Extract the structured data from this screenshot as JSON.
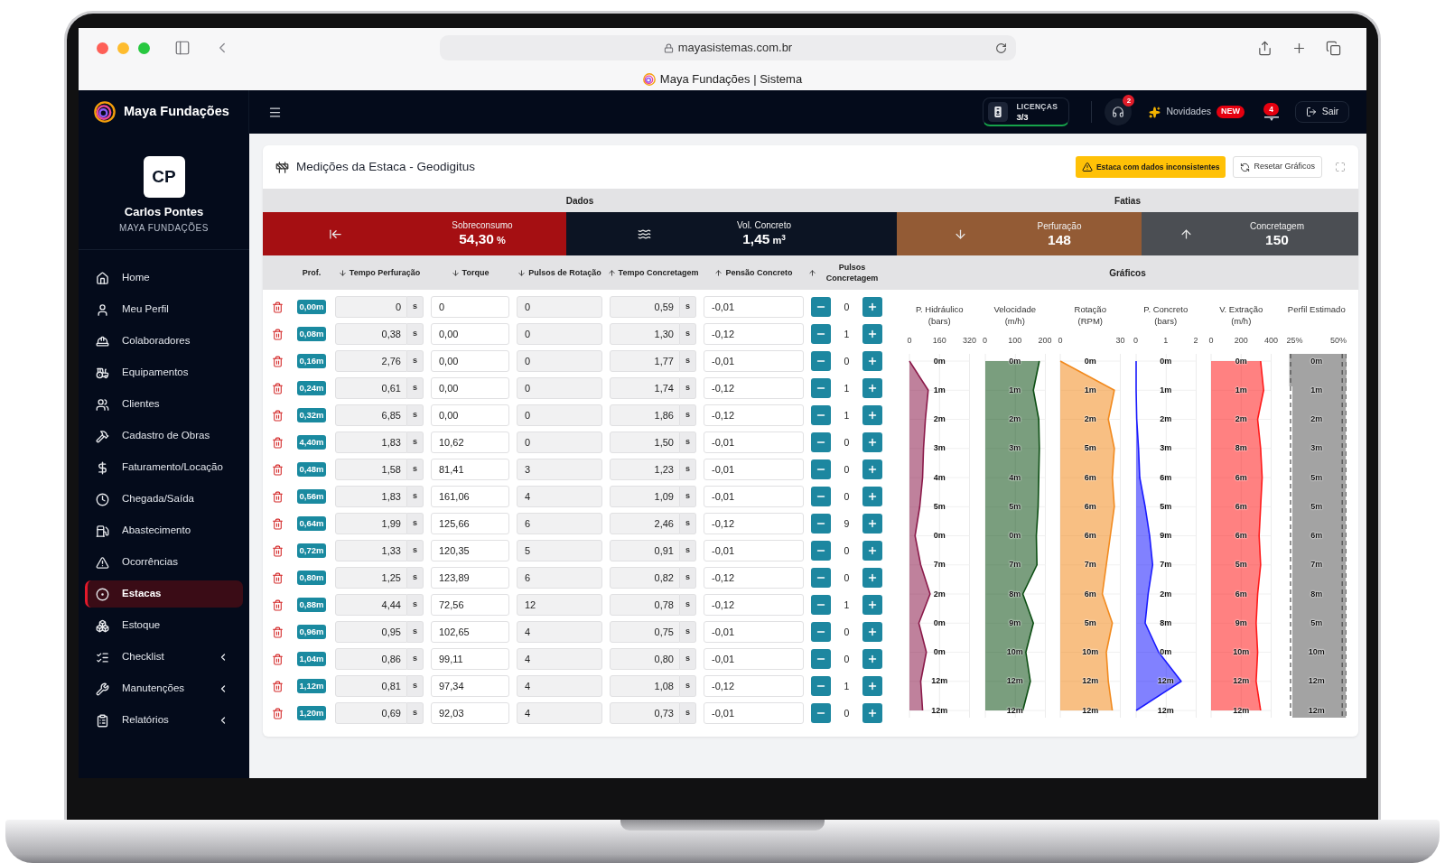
{
  "browser": {
    "url": "mayasistemas.com.br",
    "title": "Maya Fundações | Sistema"
  },
  "header": {
    "brand": "Maya Fundações",
    "licenses": {
      "label": "LICENÇAS",
      "value": "3/3"
    },
    "support": {
      "badge": "2"
    },
    "news": {
      "label": "Novidades",
      "badge": "NEW"
    },
    "alerts": {
      "badge": "4"
    },
    "logout": "Sair"
  },
  "sidebar": {
    "user": {
      "initials": "CP",
      "name": "Carlos Pontes",
      "company": "MAYA FUNDAÇÕES"
    },
    "items": [
      {
        "label": "Home",
        "kind": "link",
        "selected": false
      },
      {
        "label": "Meu Perfil",
        "kind": "link",
        "selected": false
      },
      {
        "label": "Colaboradores",
        "kind": "link",
        "selected": false
      },
      {
        "label": "Equipamentos",
        "kind": "link",
        "selected": false
      },
      {
        "label": "Clientes",
        "kind": "link",
        "selected": false
      },
      {
        "label": "Cadastro de Obras",
        "kind": "link",
        "selected": false
      },
      {
        "label": "Faturamento/Locação",
        "kind": "link",
        "selected": false
      },
      {
        "label": "Chegada/Saída",
        "kind": "link",
        "selected": false
      },
      {
        "label": "Abastecimento",
        "kind": "link",
        "selected": false
      },
      {
        "label": "Ocorrências",
        "kind": "link",
        "selected": false
      },
      {
        "label": "Estacas",
        "kind": "link",
        "selected": true
      },
      {
        "label": "Estoque",
        "kind": "link",
        "selected": false
      },
      {
        "label": "Checklist",
        "kind": "group",
        "selected": false,
        "expanded": false
      },
      {
        "label": "Manutenções",
        "kind": "group",
        "selected": false,
        "expanded": false
      },
      {
        "label": "Relatórios",
        "kind": "group",
        "selected": false,
        "expanded": false
      }
    ]
  },
  "panel": {
    "title": "Medições da Estaca - Geodigitus",
    "warning": "Estaca com dados inconsistentes",
    "reset_button": "Resetar Gráficos",
    "sections": [
      "Dados",
      "Fatias"
    ],
    "stats": [
      {
        "label": "Sobreconsumo",
        "value": "54,30",
        "unit": "%",
        "color": "#a50f12"
      },
      {
        "label": "Vol. Concreto",
        "value": "1,45",
        "unit": "m$^{3}$",
        "color": "#0c1423"
      },
      {
        "label": "Perfuração",
        "value": "148",
        "color": "#935b35"
      },
      {
        "label": "Concretagem",
        "value": "150",
        "color": "#4b4e53"
      }
    ],
    "table": {
      "columns": [
        {
          "label": "Prof.",
          "kind": "plain"
        },
        {
          "label": "Tempo Perfuração",
          "kind": "descending"
        },
        {
          "label": "Torque",
          "kind": "descending"
        },
        {
          "label": "Pulsos de Rotação",
          "kind": "descending"
        },
        {
          "label": "Tempo Concretagem",
          "kind": "ascending"
        },
        {
          "label": "Pensão Concreto",
          "kind": "ascending"
        },
        {
          "label": "Pulsos Concretagem",
          "kind": "ascending"
        }
      ],
      "rows": [
        {
          "depth": "0,00m",
          "tempo_perfuracao": {
            "value": "0",
            "unit": "s"
          },
          "torque": "0",
          "pulsos_rotacao": "0",
          "tempo_concretagem": {
            "value": "0,59",
            "unit": "s"
          },
          "pensao_concreto": "-0,01",
          "pulsos_concretagem": "0"
        },
        {
          "depth": "0,08m",
          "tempo_perfuracao": {
            "value": "0,38",
            "unit": "s"
          },
          "torque": "0,00",
          "pulsos_rotacao": "0",
          "tempo_concretagem": {
            "value": "1,30",
            "unit": "s"
          },
          "pensao_concreto": "-0,12",
          "pulsos_concretagem": "1"
        },
        {
          "depth": "0,16m",
          "tempo_perfuracao": {
            "value": "2,76",
            "unit": "s"
          },
          "torque": "0,00",
          "pulsos_rotacao": "0",
          "tempo_concretagem": {
            "value": "1,77",
            "unit": "s"
          },
          "pensao_concreto": "-0,01",
          "pulsos_concretagem": "0"
        },
        {
          "depth": "0,24m",
          "tempo_perfuracao": {
            "value": "0,61",
            "unit": "s"
          },
          "torque": "0,00",
          "pulsos_rotacao": "0",
          "tempo_concretagem": {
            "value": "1,74",
            "unit": "s"
          },
          "pensao_concreto": "-0,12",
          "pulsos_concretagem": "1"
        },
        {
          "depth": "0,32m",
          "tempo_perfuracao": {
            "value": "6,85",
            "unit": "s"
          },
          "torque": "0,00",
          "pulsos_rotacao": "0",
          "tempo_concretagem": {
            "value": "1,86",
            "unit": "s"
          },
          "pensao_concreto": "-0,12",
          "pulsos_concretagem": "1"
        },
        {
          "depth": "4,40m",
          "tempo_perfuracao": {
            "value": "1,83",
            "unit": "s"
          },
          "torque": "10,62",
          "pulsos_rotacao": "0",
          "tempo_concretagem": {
            "value": "1,50",
            "unit": "s"
          },
          "pensao_concreto": "-0,01",
          "pulsos_concretagem": "0"
        },
        {
          "depth": "0,48m",
          "tempo_perfuracao": {
            "value": "1,58",
            "unit": "s"
          },
          "torque": "81,41",
          "pulsos_rotacao": "3",
          "tempo_concretagem": {
            "value": "1,23",
            "unit": "s"
          },
          "pensao_concreto": "-0,01",
          "pulsos_concretagem": "0"
        },
        {
          "depth": "0,56m",
          "tempo_perfuracao": {
            "value": "1,83",
            "unit": "s"
          },
          "torque": "161,06",
          "pulsos_rotacao": "4",
          "tempo_concretagem": {
            "value": "1,09",
            "unit": "s"
          },
          "pensao_concreto": "-0,01",
          "pulsos_concretagem": "0"
        },
        {
          "depth": "0,64m",
          "tempo_perfuracao": {
            "value": "1,99",
            "unit": "s"
          },
          "torque": "125,66",
          "pulsos_rotacao": "6",
          "tempo_concretagem": {
            "value": "2,46",
            "unit": "s"
          },
          "pensao_concreto": "-0,12",
          "pulsos_concretagem": "9"
        },
        {
          "depth": "0,72m",
          "tempo_perfuracao": {
            "value": "1,33",
            "unit": "s"
          },
          "torque": "120,35",
          "pulsos_rotacao": "5",
          "tempo_concretagem": {
            "value": "0,91",
            "unit": "s"
          },
          "pensao_concreto": "-0,01",
          "pulsos_concretagem": "0"
        },
        {
          "depth": "0,80m",
          "tempo_perfuracao": {
            "value": "1,25",
            "unit": "s"
          },
          "torque": "123,89",
          "pulsos_rotacao": "6",
          "tempo_concretagem": {
            "value": "0,82",
            "unit": "s"
          },
          "pensao_concreto": "-0,12",
          "pulsos_concretagem": "0"
        },
        {
          "depth": "0,88m",
          "tempo_perfuracao": {
            "value": "4,44",
            "unit": "s"
          },
          "torque": "72,56",
          "pulsos_rotacao": "12",
          "tempo_concretagem": {
            "value": "0,78",
            "unit": "s"
          },
          "pensao_concreto": "-0,12",
          "pulsos_concretagem": "1"
        },
        {
          "depth": "0,96m",
          "tempo_perfuracao": {
            "value": "0,95",
            "unit": "s"
          },
          "torque": "102,65",
          "pulsos_rotacao": "4",
          "tempo_concretagem": {
            "value": "0,75",
            "unit": "s"
          },
          "pensao_concreto": "-0,01",
          "pulsos_concretagem": "0"
        },
        {
          "depth": "1,04m",
          "tempo_perfuracao": {
            "value": "0,86",
            "unit": "s"
          },
          "torque": "99,11",
          "pulsos_rotacao": "4",
          "tempo_concretagem": {
            "value": "0,80",
            "unit": "s"
          },
          "pensao_concreto": "-0,01",
          "pulsos_concretagem": "0"
        },
        {
          "depth": "1,12m",
          "tempo_perfuracao": {
            "value": "0,81",
            "unit": "s"
          },
          "torque": "97,34",
          "pulsos_rotacao": "4",
          "tempo_concretagem": {
            "value": "1,08",
            "unit": "s"
          },
          "pensao_concreto": "-0,12",
          "pulsos_concretagem": "1"
        },
        {
          "depth": "1,20m",
          "tempo_perfuracao": {
            "value": "0,69",
            "unit": "s"
          },
          "torque": "92,03",
          "pulsos_rotacao": "4",
          "tempo_concretagem": {
            "value": "0,73",
            "unit": "s"
          },
          "pensao_concreto": "-0,01",
          "pulsos_concretagem": "0"
        }
      ]
    },
    "charts": {
      "title": "Gráficos",
      "items": [
        {
          "kind": "chart",
          "chart_data": {
            "type": "area",
            "orientation": "horizontal",
            "title": "P. Hidráulico",
            "xlabel": "(bars)",
            "categories": [
              "0m",
              "1m",
              "2m",
              "3m",
              "4m",
              "5m",
              "0m",
              "7m",
              "2m",
              "0m",
              "0m",
              "12m",
              "12m"
            ],
            "series": [
              {
                "color": "#8b1a4a",
                "values": [
                  0,
                  100,
                  85,
                  75,
                  70,
                  55,
                  30,
                  60,
                  110,
                  50,
                  90,
                  60,
                  70
                ]
              }
            ],
            "xlim": [
              0,
              320
            ],
            "xticks": [
              0,
              160,
              320
            ],
            "grid": true
          }
        },
        {
          "kind": "chart",
          "chart_data": {
            "type": "area",
            "orientation": "horizontal",
            "title": "Velocidade",
            "xlabel": "(m/h)",
            "categories": [
              "0m",
              "1m",
              "2m",
              "3m",
              "4m",
              "5m",
              "0m",
              "7m",
              "8m",
              "9m",
              "10m",
              "12m",
              "12m"
            ],
            "series": [
              {
                "color": "#0d4f14",
                "values": [
                  180,
                  160,
                  178,
                  180,
                  178,
                  176,
                  170,
                  172,
                  125,
                  160,
                  135,
                  150,
                  125
                ]
              }
            ],
            "xlim": [
              0,
              200
            ],
            "xticks": [
              0,
              100,
              200
            ],
            "grid": true
          }
        },
        {
          "kind": "chart",
          "chart_data": {
            "type": "area",
            "orientation": "horizontal",
            "title": "Rotação",
            "xlabel": "(RPM)",
            "categories": [
              "0m",
              "1m",
              "2m",
              "5m",
              "6m",
              "6m",
              "6m",
              "7m",
              "6m",
              "5m",
              "10m",
              "12m",
              "12m"
            ],
            "series": [
              {
                "color": "#f28a1e",
                "values": [
                  0,
                  27,
                  24,
                  27,
                  26,
                  27,
                  25,
                  23,
                  21,
                  26,
                  23,
                  24,
                  26
                ]
              }
            ],
            "xlim": [
              0,
              30
            ],
            "xticks": [
              0,
              30
            ],
            "grid": true
          }
        },
        {
          "kind": "chart",
          "chart_data": {
            "type": "area",
            "orientation": "horizontal",
            "title": "P. Concreto",
            "xlabel": "(bars)",
            "categories": [
              "0m",
              "1m",
              "2m",
              "3m",
              "6m",
              "5m",
              "9m",
              "7m",
              "2m",
              "8m",
              "0m",
              "12m",
              "12m"
            ],
            "series": [
              {
                "color": "#1a1aff",
                "values": [
                  0,
                  0,
                  0.02,
                  0.08,
                  0.12,
                  0.3,
                  0.45,
                  0.55,
                  0.4,
                  0.3,
                  0.75,
                  1.5,
                  0
                ]
              }
            ],
            "xlim": [
              0,
              2
            ],
            "xticks": [
              0,
              1,
              2
            ],
            "grid": true
          }
        },
        {
          "kind": "chart",
          "chart_data": {
            "type": "area",
            "orientation": "horizontal",
            "title": "V. Extração",
            "xlabel": "(m/h)",
            "categories": [
              "0m",
              "1m",
              "2m",
              "8m",
              "6m",
              "6m",
              "6m",
              "5m",
              "6m",
              "9m",
              "10m",
              "12m",
              "12m"
            ],
            "series": [
              {
                "color": "#ff1a1a",
                "values": [
                  330,
                  350,
                  310,
                  330,
                  340,
                  330,
                  320,
                  330,
                  310,
                  300,
                  310,
                  300,
                  330
                ]
              }
            ],
            "xlim": [
              0,
              400
            ],
            "xticks": [
              0,
              200,
              400
            ],
            "grid": true
          }
        },
        {
          "kind": "picture",
          "title": "Perfil Estimado",
          "ticks": [
            "25%",
            "50%"
          ],
          "depth_labels": [
            "0m",
            "1m",
            "2m",
            "3m",
            "5m",
            "5m",
            "6m",
            "7m",
            "8m",
            "5m",
            "10m",
            "12m",
            "12m"
          ]
        }
      ]
    }
  }
}
